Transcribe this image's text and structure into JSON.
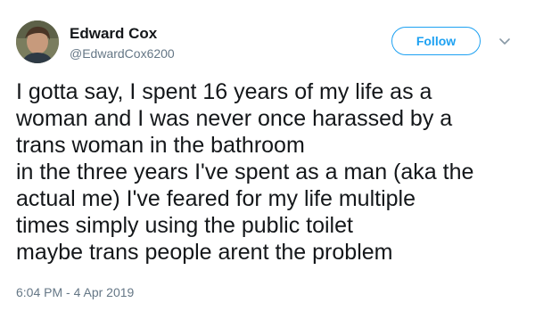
{
  "author": {
    "name": "Edward Cox",
    "handle": "@EdwardCox6200",
    "avatar_icon": "user-photo"
  },
  "header": {
    "follow_label": "Follow",
    "menu_icon": "chevron-down-icon"
  },
  "tweet": {
    "lines": [
      "I gotta say, I spent 16 years of my life as a",
      "woman and I was never once harassed by a",
      "trans woman in the bathroom",
      "in the three years I've spent as a man (aka the",
      "actual me) I've feared for my life multiple",
      "times simply using the public toilet",
      "maybe trans people arent the problem"
    ],
    "timestamp": "6:04 PM - 4 Apr 2019"
  },
  "colors": {
    "accent": "#1da1f2",
    "text": "#14171a",
    "muted": "#657786"
  }
}
